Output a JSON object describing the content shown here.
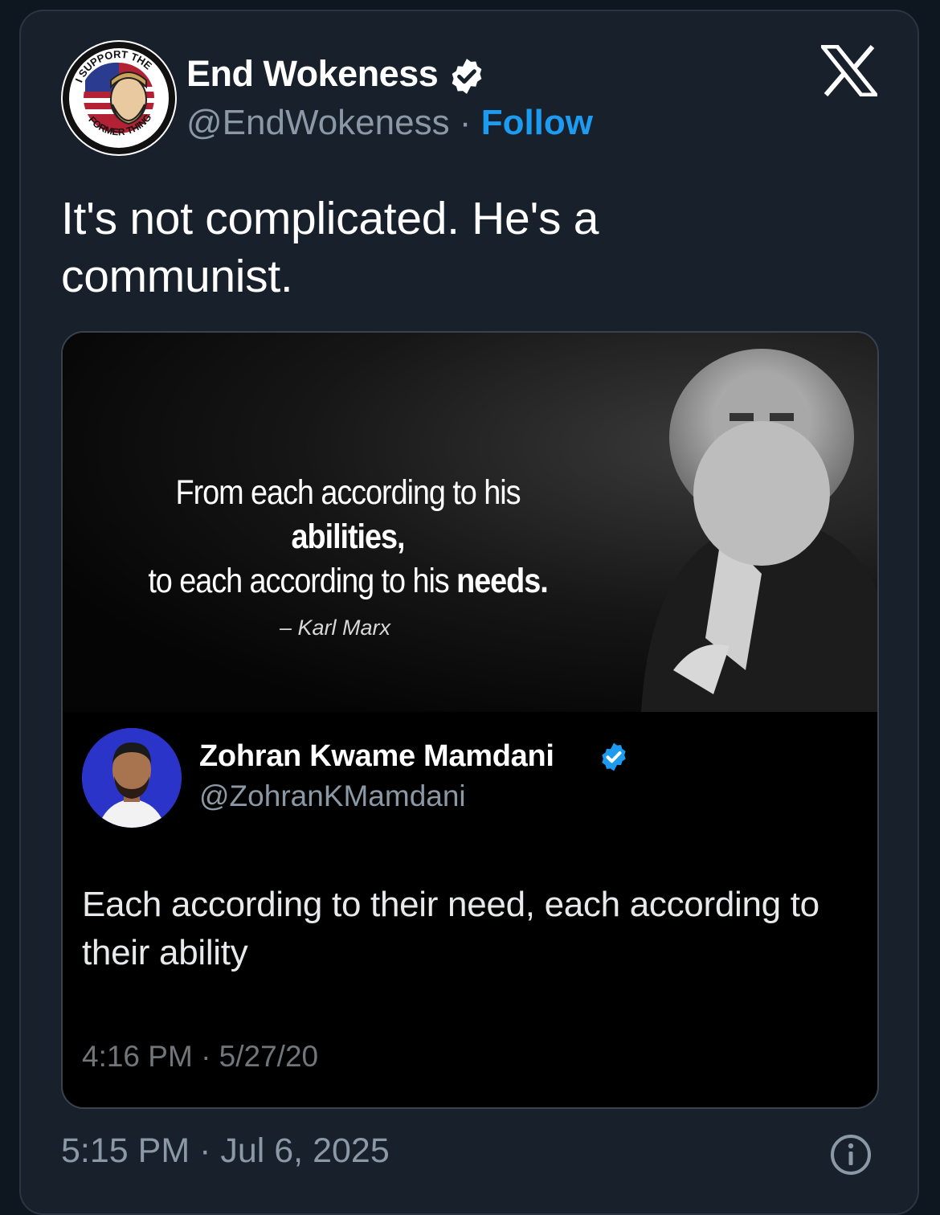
{
  "author": {
    "name": "End Wokeness",
    "handle": "@EndWokeness",
    "separator": " · ",
    "follow_label": "Follow",
    "avatar_texts": [
      "I SUPPORT THE",
      "FORMER THING"
    ]
  },
  "tweet": {
    "text": "It's not complicated. He's a communist.",
    "timestamp": "5:15 PM · Jul 6, 2025"
  },
  "media": {
    "quote_line1_prefix": "From each according to his ",
    "quote_line1_bold": "abilities,",
    "quote_line2_prefix": "to each according to his ",
    "quote_line2_bold": "needs.",
    "attribution": "– Karl Marx",
    "embedded_tweet": {
      "name": "Zohran Kwame Mamdani",
      "handle": "@ZohranKMamdani",
      "text": "Each according to their need, each according to their ability",
      "timestamp": "4:16 PM · 5/27/20"
    }
  },
  "icons": {
    "verified": "verified-badge-icon",
    "platform": "x-logo-icon",
    "info": "info-icon"
  },
  "colors": {
    "background": "#17202b",
    "accent": "#1d9bf0",
    "secondary_text": "#8b98a5"
  }
}
